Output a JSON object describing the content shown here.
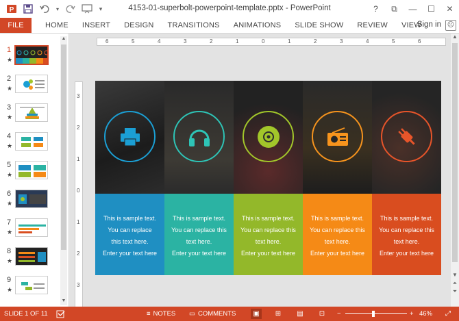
{
  "window": {
    "title": "4153-01-superbolt-powerpoint-template.pptx - PowerPoint",
    "controls": [
      "?",
      "⧉",
      "—",
      "☐",
      "✕"
    ]
  },
  "quick_access": {
    "icons": [
      "powerpoint-logo-icon",
      "save-icon",
      "undo-icon",
      "redo-icon",
      "presenter-icon",
      "customize-icon"
    ]
  },
  "ribbon": {
    "file_label": "FILE",
    "tabs": [
      "HOME",
      "INSERT",
      "DESIGN",
      "TRANSITIONS",
      "ANIMATIONS",
      "SLIDE SHOW",
      "REVIEW",
      "VIEW"
    ],
    "signin_label": "Sign in"
  },
  "thumbnails": {
    "numbers": [
      "1",
      "2",
      "3",
      "4",
      "5",
      "6",
      "7",
      "8",
      "9"
    ],
    "star": "★",
    "selected": "1"
  },
  "ruler": {
    "horizontal": [
      "6",
      "5",
      "4",
      "3",
      "2",
      "1",
      "0",
      "1",
      "2",
      "3",
      "4",
      "5",
      "6"
    ],
    "vertical": [
      "3",
      "2",
      "1",
      "0",
      "1",
      "2",
      "3"
    ]
  },
  "slide": {
    "columns": [
      {
        "icon": "printer-icon",
        "accent": "#1b9fd4",
        "panel_color": "#1f8fc2",
        "photo_color": "#2a2a2a",
        "lines": [
          "This is sample text.",
          "You can replace",
          "this text here.",
          "Enter your text here"
        ]
      },
      {
        "icon": "headphones-icon",
        "accent": "#2ec4b6",
        "panel_color": "#2bb3a3",
        "photo_color": "#333333",
        "lines": [
          "This is sample text.",
          "You can replace this",
          "text here.",
          "Enter your text here"
        ]
      },
      {
        "icon": "disc-icon",
        "accent": "#a2c62a",
        "panel_color": "#93b82a",
        "photo_color": "#2e2e2e",
        "lines": [
          "This is sample text.",
          "You can replace this",
          "text here.",
          "Enter your text here"
        ]
      },
      {
        "icon": "radio-icon",
        "accent": "#f7941d",
        "panel_color": "#f58a16",
        "photo_color": "#262626",
        "lines": [
          "This is sample text.",
          "You can replace this",
          "text here.",
          "Enter your text here"
        ]
      },
      {
        "icon": "plug-icon",
        "accent": "#e8552a",
        "panel_color": "#d94d1f",
        "photo_color": "#303030",
        "lines": [
          "This is sample text.",
          "You can replace this",
          "text here.",
          "Enter your text here"
        ]
      }
    ]
  },
  "status": {
    "slide_of": "SLIDE 1 OF 11",
    "notes_label": "NOTES",
    "comments_label": "COMMENTS",
    "zoom_minus": "−",
    "zoom_plus": "+",
    "zoom": "46%",
    "bar_color": "#d24726"
  }
}
